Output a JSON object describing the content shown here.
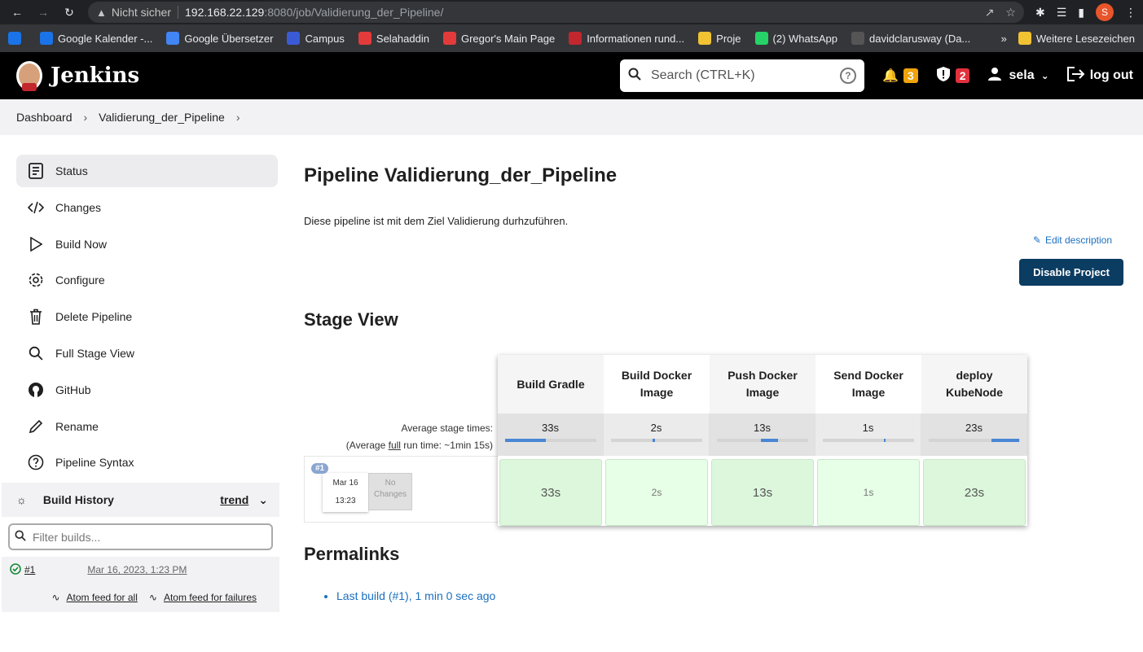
{
  "browser": {
    "insecure_label": "Nicht sicher",
    "url_host": "192.168.22.129",
    "url_rest": ":8080/job/Validierung_der_Pipeline/",
    "profile_initial": "S",
    "bookmarks": [
      {
        "label": "",
        "color": "#1a73e8",
        "icon": "apps-icon"
      },
      {
        "label": "Google Kalender -...",
        "color": "#1a73e8",
        "icon": "calendar-icon",
        "glyph": "13"
      },
      {
        "label": "Google Übersetzer",
        "color": "#4285f4",
        "icon": "translate-icon",
        "glyph": "G"
      },
      {
        "label": "Campus",
        "color": "#3b5bd6",
        "icon": "campus-icon",
        "glyph": "C"
      },
      {
        "label": "Selahaddin",
        "color": "#e33b3b",
        "icon": "pin-icon",
        "glyph": "📌"
      },
      {
        "label": "Gregor's Main Page",
        "color": "#e33b3b",
        "icon": "pin-icon",
        "glyph": "📌"
      },
      {
        "label": "Informationen rund...",
        "color": "#c1272d",
        "icon": "a-icon",
        "glyph": "A"
      },
      {
        "label": "Proje",
        "color": "#f1c232",
        "icon": "folder-icon",
        "glyph": ""
      },
      {
        "label": "(2) WhatsApp",
        "color": "#25d366",
        "icon": "whatsapp-icon",
        "glyph": "1"
      },
      {
        "label": "davidclarusway (Da...",
        "color": "#555",
        "icon": "github-icon",
        "glyph": "●"
      }
    ],
    "more_bookmarks": "»",
    "other_bookmarks": "Weitere Lesezeichen"
  },
  "header": {
    "brand": "Jenkins",
    "search_placeholder": "Search (CTRL+K)",
    "notifications_count": "3",
    "security_count": "2",
    "user": "sela",
    "logout": "log out"
  },
  "breadcrumb": [
    "Dashboard",
    "Validierung_der_Pipeline"
  ],
  "sidebar": {
    "tasks": [
      {
        "label": "Status",
        "icon": "status-icon"
      },
      {
        "label": "Changes",
        "icon": "code-icon"
      },
      {
        "label": "Build Now",
        "icon": "play-icon"
      },
      {
        "label": "Configure",
        "icon": "gear-icon"
      },
      {
        "label": "Delete Pipeline",
        "icon": "trash-icon"
      },
      {
        "label": "Full Stage View",
        "icon": "search-icon"
      },
      {
        "label": "GitHub",
        "icon": "github-icon"
      },
      {
        "label": "Rename",
        "icon": "pencil-icon"
      },
      {
        "label": "Pipeline Syntax",
        "icon": "help-icon"
      }
    ],
    "build_history": {
      "title": "Build History",
      "trend": "trend",
      "filter_placeholder": "Filter builds...",
      "builds": [
        {
          "number": "#1",
          "date": "Mar 16, 2023, 1:23 PM"
        }
      ],
      "feed_all": "Atom feed for all",
      "feed_failures": "Atom feed for failures"
    }
  },
  "main": {
    "title": "Pipeline Validierung_der_Pipeline",
    "description": "Diese pipeline ist mit dem Ziel Validierung durhzuführen.",
    "edit_description": "Edit description",
    "disable_button": "Disable Project",
    "stage_view_title": "Stage View",
    "avg_stage_label": "Average stage times:",
    "avg_run_prefix": "(Average ",
    "avg_run_full": "full",
    "avg_run_suffix": " run time: ~1min 15s)",
    "stages": [
      {
        "name": "Build Gradle",
        "avg": "33s",
        "bar_start": 0,
        "bar_width": 0.45,
        "run": "33s",
        "shade": "dark",
        "size": "normal"
      },
      {
        "name": "Build Docker Image",
        "avg": "2s",
        "bar_start": 0.46,
        "bar_width": 0.03,
        "run": "2s",
        "shade": "light",
        "size": "small"
      },
      {
        "name": "Push Docker Image",
        "avg": "13s",
        "bar_start": 0.49,
        "bar_width": 0.18,
        "run": "13s",
        "shade": "dark",
        "size": "normal"
      },
      {
        "name": "Send Docker Image",
        "avg": "1s",
        "bar_start": 0.67,
        "bar_width": 0.02,
        "run": "1s",
        "shade": "light",
        "size": "small"
      },
      {
        "name": "deploy KubeNode",
        "avg": "23s",
        "bar_start": 0.69,
        "bar_width": 0.31,
        "run": "23s",
        "shade": "dark",
        "size": "normal"
      }
    ],
    "build": {
      "badge": "#1",
      "date": "Mar 16",
      "time": "13:23",
      "changes": "No Changes"
    },
    "permalinks_title": "Permalinks",
    "permalinks": [
      "Last build (#1), 1 min 0 sec ago"
    ]
  }
}
